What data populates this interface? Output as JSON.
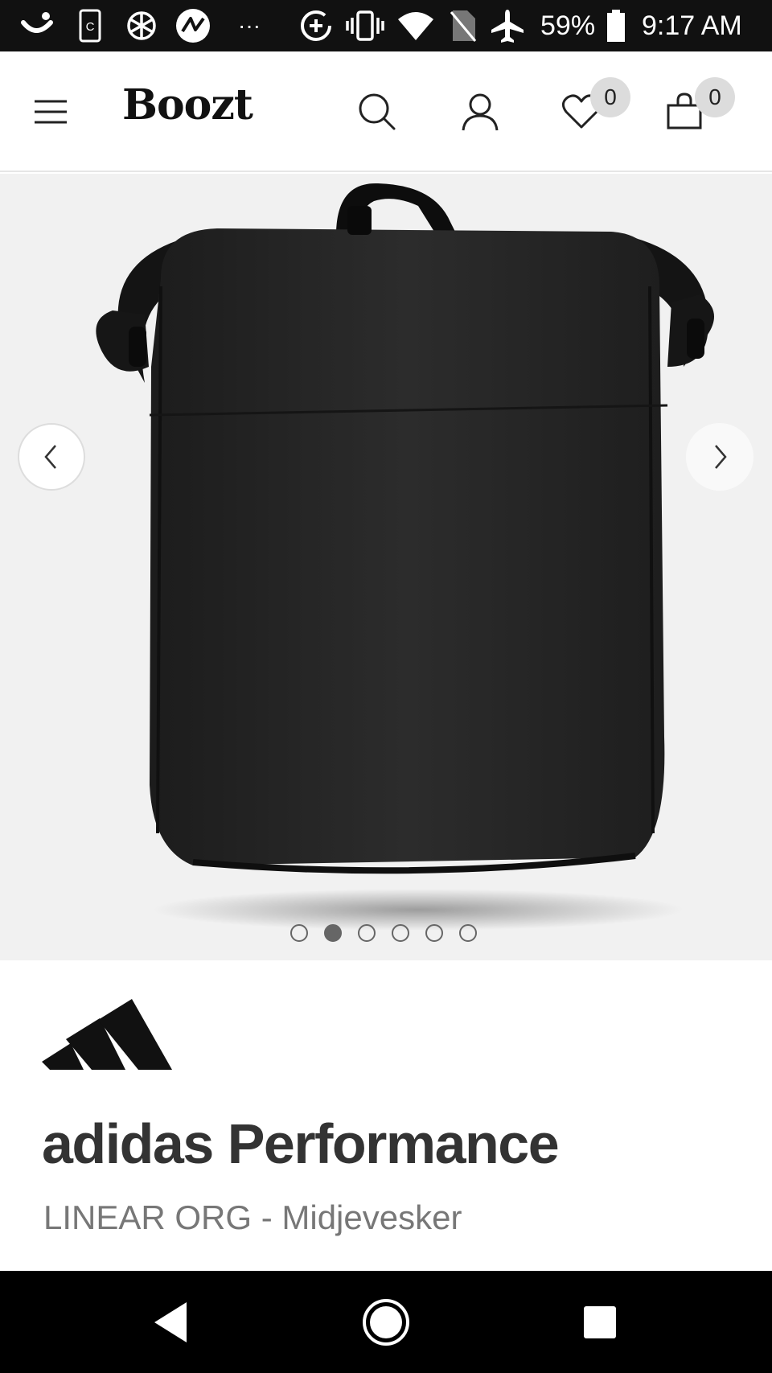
{
  "status_bar": {
    "battery_percent": "59%",
    "time": "9:17 AM",
    "overflow_glyph": "···",
    "icons": [
      "smile-icon",
      "phone-app-icon",
      "openai-icon",
      "activity-icon",
      "data-saver-icon",
      "vibrate-icon",
      "wifi-icon",
      "no-sim-icon",
      "airplane-mode-icon",
      "battery-icon"
    ]
  },
  "header": {
    "logo_text": "Boozt",
    "wishlist_count": "0",
    "cart_count": "0",
    "icons": [
      "menu-icon",
      "search-icon",
      "account-icon",
      "heart-icon",
      "bag-icon"
    ]
  },
  "gallery": {
    "image_count": 6,
    "current_index": 2,
    "background": "#f1f1f1",
    "icons": [
      "chevron-left-icon",
      "chevron-right-icon"
    ]
  },
  "product": {
    "brand": "adidas Performance",
    "name": "LINEAR ORG - Midjevesker",
    "brand_logo_icon": "adidas-performance-logo-icon"
  },
  "nav_bar": {
    "icons": [
      "back-icon",
      "home-icon",
      "recents-icon"
    ]
  }
}
